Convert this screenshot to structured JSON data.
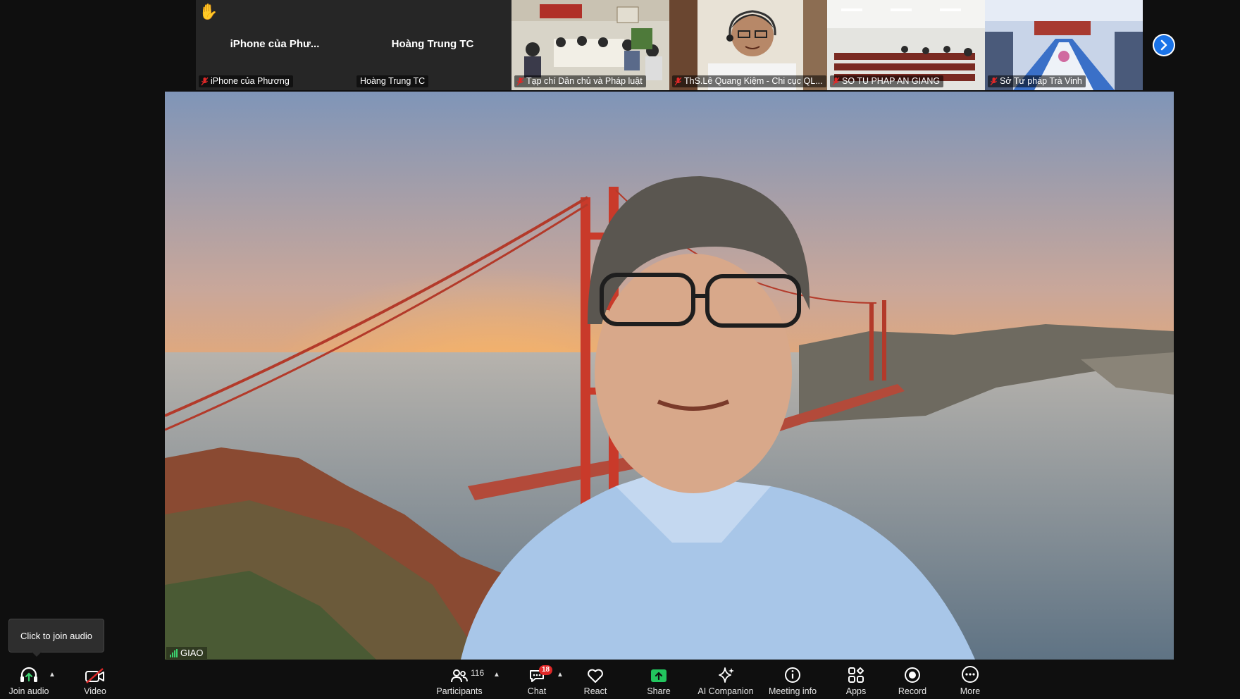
{
  "gallery": {
    "tiles": [
      {
        "center_name": "iPhone của Phư...",
        "label": "iPhone của Phương",
        "raised_hand": true
      },
      {
        "center_name": "Hoàng Trung TC",
        "label": "Hoàng Trung TC"
      },
      {
        "label": "Tạp chí Dân chủ và Pháp luật"
      },
      {
        "label": "ThS.Lê Quang Kiệm - Chi cục QL..."
      },
      {
        "label": "SO TU PHAP AN GIANG"
      },
      {
        "label": "Sở Tư pháp Trà Vinh"
      }
    ]
  },
  "main_video": {
    "speaker_name": "GIAO"
  },
  "tooltip": {
    "text": "Click to join audio"
  },
  "toolbar": {
    "join_audio": "Join audio",
    "video": "Video",
    "participants": "Participants",
    "participants_count": "116",
    "chat": "Chat",
    "chat_badge": "18",
    "react": "React",
    "share": "Share",
    "ai_companion": "AI Companion",
    "meeting_info": "Meeting info",
    "apps": "Apps",
    "record": "Record",
    "more": "More"
  },
  "colors": {
    "share_green": "#22c55e",
    "badge_red": "#e02828",
    "muted_red": "#e02828",
    "audio_green": "#3bd16f"
  }
}
